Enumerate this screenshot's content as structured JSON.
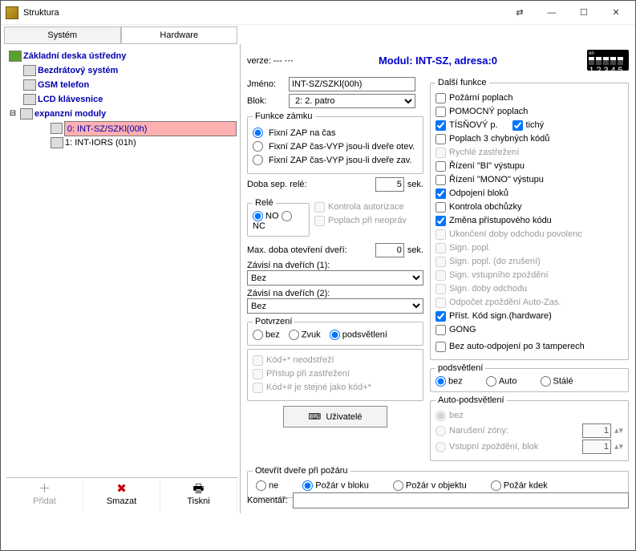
{
  "window": {
    "title": "Struktura"
  },
  "tabs": {
    "system": "Systém",
    "hardware": "Hardware"
  },
  "tree": {
    "root": "Základní deska ústředny",
    "n1": "Bezdrátový systém",
    "n2": "GSM telefon",
    "n3": "LCD klávesnice",
    "n4": "expanzní moduly",
    "n4a": "0: INT-SZ/SZKl(00h)",
    "n4b": "1: INT-IORS (01h)"
  },
  "buttons": {
    "add": "Přidat",
    "del": "Smazat",
    "print": "Tiskni"
  },
  "header": {
    "verlabel": "verze:",
    "ver": "--- ⋯",
    "module": "Modul: INT-SZ, adresa:0",
    "dipnums": [
      "1",
      "2",
      "3",
      "4",
      "5"
    ]
  },
  "labels": {
    "name": "Jméno:",
    "block": "Blok:",
    "lockfn": "Funkce zámku",
    "r1": "Fixní ZAP na čas",
    "r2": "Fixní ZAP čas-VYP jsou-li dveře otev.",
    "r3": "Fixní ZAP čas-VYP jsou-li dveře zav.",
    "septime": "Doba sep. relé:",
    "sec": "sek.",
    "relay": "Relé",
    "no": "NO",
    "nc": "NC",
    "auth": "Kontrola autorizace",
    "unauth": "Poplach při neopráv",
    "maxopen": "Max. doba otevření dveří:",
    "dep1": "Závisí na dveřích (1):",
    "dep2": "Závisí na dveřích (2):",
    "bez": "Bez",
    "confirm": "Potvrzení",
    "cbez": "bez",
    "czvuk": "Zvuk",
    "clight": "podsvětlení",
    "k1": "Kód+* neodstřeží",
    "k2": "Přístup při zastřežení",
    "k3": "Kód+# je stejné jako kód+*",
    "users": "Uživatelé",
    "other": "Další funkce",
    "f1": "Požární poplach",
    "f2": "POMOCNÝ poplach",
    "f3": "TÍSŇOVÝ p.",
    "f3b": "tichý",
    "f4": "Poplach 3 chybných kódů",
    "f5": "Rychlé zastřežení",
    "f6": "Řízení \"BI\" výstupu",
    "f7": "Řízení \"MONO\" výstupu",
    "f8": "Odpojení bloků",
    "f9": "Kontrola obchůzky",
    "f10": "Změna přístupového kódu",
    "f11": "Ukončení doby odchodu povolenc",
    "f12": "Sign. popl.",
    "f13": "Sign. popl. (do zrušení)",
    "f14": "Sign. vstupního zpoždění",
    "f15": "Sign. doby odchodu",
    "f16": "Odpočet zpoždění Auto-Zas.",
    "f17": "Příst. Kód sign.(hardware)",
    "f18": "GONG",
    "f19": "Bez auto-odpojení po 3 tamperech",
    "backlight": "podsvětlení",
    "blbez": "bez",
    "blauto": "Auto",
    "blstale": "Stálé",
    "autobl": "Auto-podsvětlení",
    "ab1": "bez",
    "ab2": "Narušení zóny:",
    "ab3": "Vstupní zpoždění, blok",
    "fire": "Otevřít dveře při požáru",
    "fi1": "ne",
    "fi2": "Požár v bloku",
    "fi3": "Požár v objektu",
    "fi4": "Požár kdek",
    "comment": "Komentář:"
  },
  "values": {
    "name": "INT-SZ/SZKl(00h)",
    "block": "2: 2. patro",
    "septime": "5",
    "maxopen": "0",
    "ab2": "1",
    "ab3": "1"
  }
}
